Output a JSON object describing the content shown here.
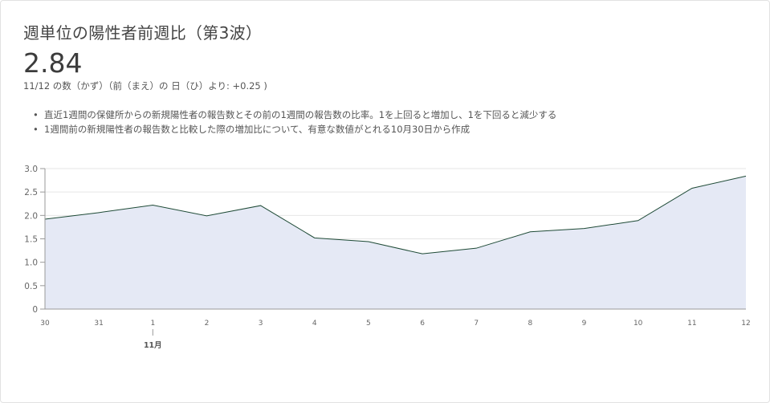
{
  "card": {
    "title": "週単位の陽性者前週比（第3波）",
    "value": "2.84",
    "subline": "11/12 の数（かず）（前（まえ）の 日（ひ）より: +0.25 )",
    "notes": [
      "直近1週間の保健所からの新規陽性者の報告数とその前の1週間の報告数の比率。1を上回ると増加し、1を下回ると減少する",
      "1週間前の新規陽性者の報告数と比較した際の増加比について、有意な数値がとれる10月30日から作成"
    ]
  },
  "colors": {
    "line": "#1e4a36",
    "fill": "#e5e9f5",
    "grid": "#e6e6e6",
    "axis": "#999999"
  },
  "chart_data": {
    "type": "area",
    "title": "",
    "xlabel": "",
    "ylabel": "",
    "categories": [
      "30",
      "31",
      "1",
      "2",
      "3",
      "4",
      "5",
      "6",
      "7",
      "8",
      "9",
      "10",
      "11",
      "12"
    ],
    "month_marker": {
      "category": "1",
      "label": "11月"
    },
    "values": [
      1.92,
      2.06,
      2.22,
      1.99,
      2.21,
      1.52,
      1.44,
      1.18,
      1.3,
      1.65,
      1.72,
      1.89,
      2.58,
      2.84
    ],
    "ylim": [
      0,
      3.0
    ],
    "yticks": [
      "0",
      "0.5",
      "1.0",
      "1.5",
      "2.0",
      "2.5",
      "3.0"
    ],
    "grid": true,
    "legend": "none"
  }
}
